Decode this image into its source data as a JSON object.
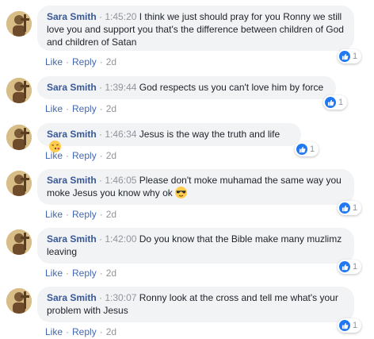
{
  "comments": [
    {
      "author": "Sara Smith",
      "separator": " · ",
      "time": "1:45:20",
      "text": "I think we just should pray for you Ronny we still love you and support you that's the difference between children of God and children of Satan",
      "like": "Like",
      "reply": "Reply",
      "dot": "·",
      "age": "2d",
      "reaction_count": "1"
    },
    {
      "author": "Sara Smith",
      "separator": " · ",
      "time": "1:39:44",
      "text": "God respects us you can't love him by force",
      "like": "Like",
      "reply": "Reply",
      "dot": "·",
      "age": "2d",
      "reaction_count": "1"
    },
    {
      "author": "Sara Smith",
      "separator": " · ",
      "time": "1:46:34",
      "text": "Jesus is the way the truth and life",
      "emoji": "face-blowing-kiss-emoji",
      "like": "Like",
      "reply": "Reply",
      "dot": "·",
      "age": "2d",
      "reaction_count": "1"
    },
    {
      "author": "Sara Smith",
      "separator": " · ",
      "time": "1:46:05",
      "text": "Please don't moke muhamad the same way you moke Jesus you know why ok",
      "emoji": "sunglasses-face-emoji",
      "like": "Like",
      "reply": "Reply",
      "dot": "·",
      "age": "2d",
      "reaction_count": "1"
    },
    {
      "author": "Sara Smith",
      "separator": " · ",
      "time": "1:42:00",
      "text": "Do you know that the Bible make many muzlimz leaving",
      "like": "Like",
      "reply": "Reply",
      "dot": "·",
      "age": "2d",
      "reaction_count": "1"
    },
    {
      "author": "Sara Smith",
      "separator": " · ",
      "time": "1:30:07",
      "text": "Ronny look at the cross and tell me what's your problem with Jesus",
      "like": "Like",
      "reply": "Reply",
      "dot": "·",
      "age": "2d",
      "reaction_count": "1"
    }
  ],
  "colors": {
    "author": "#385898",
    "link": "#4267b2",
    "meta": "#90949c",
    "bubble": "#f2f3f5",
    "like_badge": "#2078f4"
  }
}
